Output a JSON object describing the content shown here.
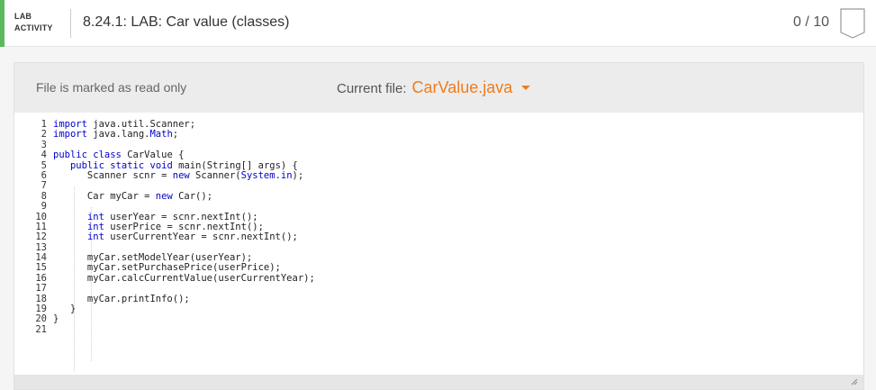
{
  "header": {
    "lab_line1": "LAB",
    "lab_line2": "ACTIVITY",
    "title": "8.24.1: LAB: Car value (classes)",
    "score": "0 / 10",
    "accent_color": "#5cb85c"
  },
  "toolbar": {
    "readonly_text": "File is marked as read only",
    "current_file_label": "Current file:",
    "current_file_name": "CarValue.java",
    "file_color": "#f07c1d"
  },
  "code": {
    "line_numbers": [
      "1",
      "2",
      "3",
      "4",
      "5",
      "6",
      "7",
      "8",
      "9",
      "10",
      "11",
      "12",
      "13",
      "14",
      "15",
      "16",
      "17",
      "18",
      "19",
      "20",
      "21"
    ],
    "lines": [
      "import java.util.Scanner;",
      "import java.lang.Math;",
      "",
      "public class CarValue {",
      "   public static void main(String[] args) {",
      "      Scanner scnr = new Scanner(System.in);",
      "",
      "      Car myCar = new Car();",
      "",
      "      int userYear = scnr.nextInt();",
      "      int userPrice = scnr.nextInt();",
      "      int userCurrentYear = scnr.nextInt();",
      "",
      "      myCar.setModelYear(userYear);",
      "      myCar.setPurchasePrice(userPrice);",
      "      myCar.calcCurrentValue(userCurrentYear);",
      "",
      "      myCar.printInfo();",
      "   }",
      "}",
      ""
    ]
  }
}
